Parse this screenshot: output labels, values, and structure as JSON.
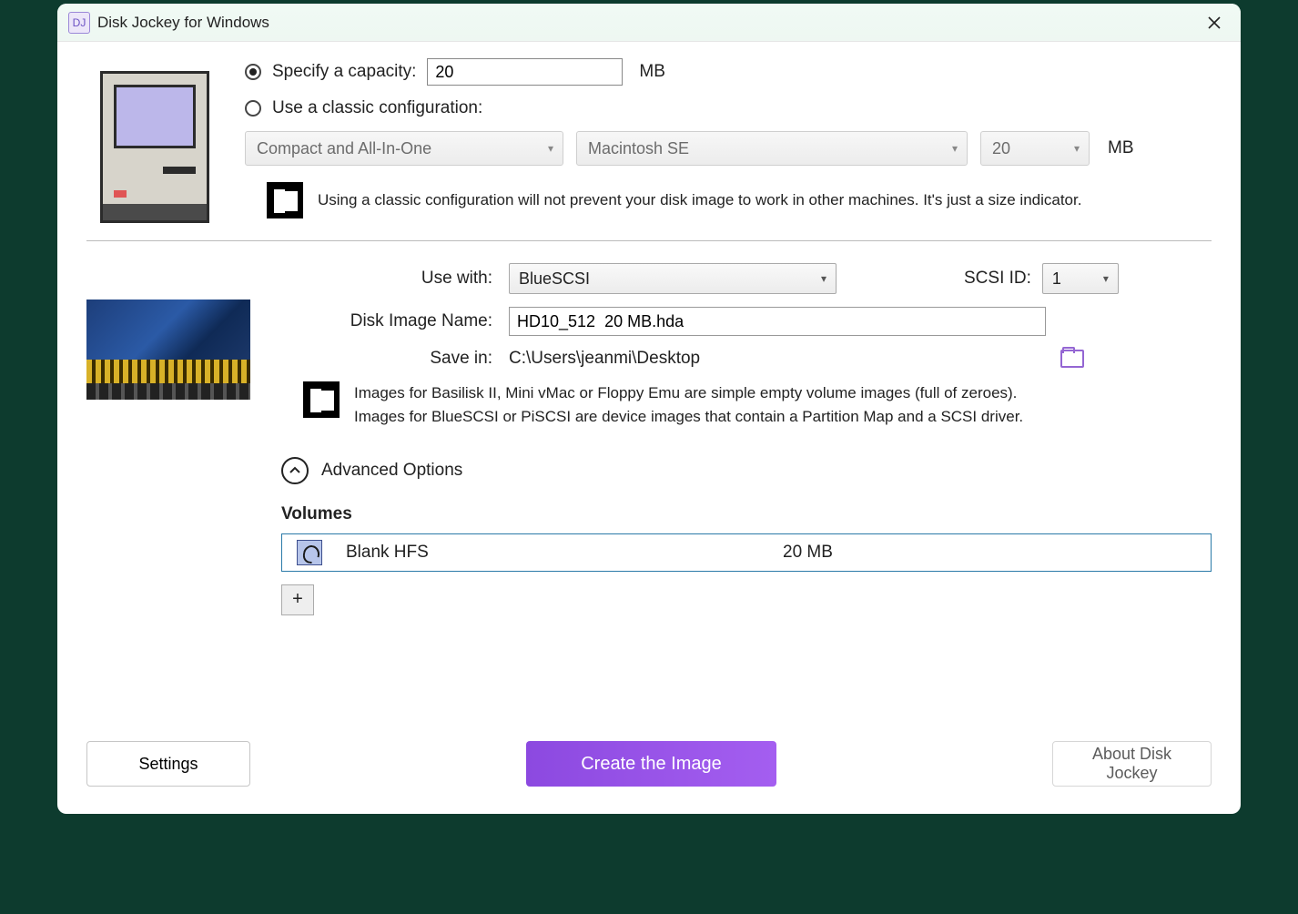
{
  "window": {
    "title": "Disk Jockey for Windows"
  },
  "capacity": {
    "specify_label": "Specify a capacity:",
    "value": "20",
    "unit": "MB",
    "classic_label": "Use a classic configuration:"
  },
  "classic_dd": {
    "category": "Compact and All-In-One",
    "model": "Macintosh SE",
    "size": "20",
    "size_unit": "MB"
  },
  "info1": "Using a classic configuration will not prevent your disk image to work in other machines. It's just a size indicator.",
  "form": {
    "usewith_label": "Use with:",
    "usewith_value": "BlueSCSI",
    "scsi_label": "SCSI ID:",
    "scsi_value": "1",
    "imagename_label": "Disk Image Name:",
    "imagename_value": "HD10_512  20 MB.hda",
    "savein_label": "Save in:",
    "savein_value": "C:\\Users\\jeanmi\\Desktop"
  },
  "info2_l1": "Images for Basilisk II, Mini vMac or Floppy Emu are simple empty volume images (full of zeroes).",
  "info2_l2": "Images for BlueSCSI or PiSCSI are device images that contain a Partition Map and a SCSI driver.",
  "advanced_label": "Advanced Options",
  "volumes": {
    "heading": "Volumes",
    "rows": [
      {
        "name": "Blank HFS",
        "size": "20 MB"
      }
    ],
    "add": "+"
  },
  "footer": {
    "settings": "Settings",
    "create": "Create the Image",
    "about": "About Disk Jockey"
  }
}
